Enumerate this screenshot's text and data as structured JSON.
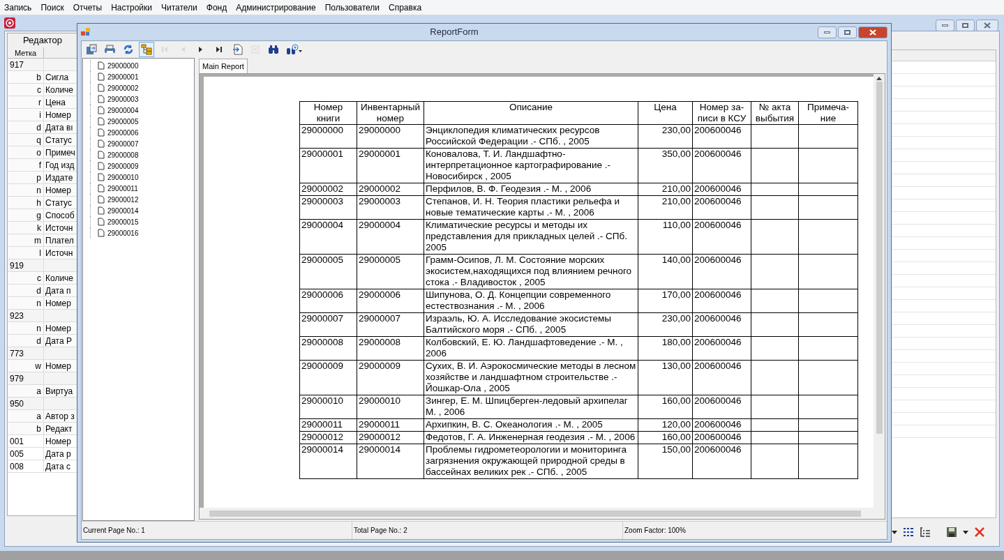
{
  "menu": [
    "Запись",
    "Поиск",
    "Отчеты",
    "Настройки",
    "Читатели",
    "Фонд",
    "Администрирование",
    "Пользователи",
    "Справка"
  ],
  "editor": {
    "tab": "Редактор",
    "column": "Метка",
    "rows": [
      {
        "kind": "group",
        "tag": "917"
      },
      {
        "kind": "sub",
        "tag": "b",
        "name": "Сигла"
      },
      {
        "kind": "sub",
        "tag": "c",
        "name": "Количе"
      },
      {
        "kind": "sub",
        "tag": "r",
        "name": "Цена"
      },
      {
        "kind": "sub",
        "tag": "i",
        "name": "Номер"
      },
      {
        "kind": "sub",
        "tag": "d",
        "name": "Дата вı"
      },
      {
        "kind": "sub",
        "tag": "q",
        "name": "Статус"
      },
      {
        "kind": "sub",
        "tag": "o",
        "name": "Примеч"
      },
      {
        "kind": "sub",
        "tag": "f",
        "name": "Год изд"
      },
      {
        "kind": "sub",
        "tag": "p",
        "name": "Издате"
      },
      {
        "kind": "sub",
        "tag": "n",
        "name": "Номер"
      },
      {
        "kind": "sub",
        "tag": "h",
        "name": "Статус"
      },
      {
        "kind": "sub",
        "tag": "g",
        "name": "Способ"
      },
      {
        "kind": "sub",
        "tag": "k",
        "name": "Источн"
      },
      {
        "kind": "sub",
        "tag": "m",
        "name": "Плател"
      },
      {
        "kind": "sub",
        "tag": "l",
        "name": "Источн"
      },
      {
        "kind": "group",
        "tag": "919"
      },
      {
        "kind": "sub",
        "tag": "c",
        "name": "Количе"
      },
      {
        "kind": "sub",
        "tag": "d",
        "name": "Дата п"
      },
      {
        "kind": "sub",
        "tag": "n",
        "name": "Номер"
      },
      {
        "kind": "group",
        "tag": "923"
      },
      {
        "kind": "sub",
        "tag": "n",
        "name": "Номер"
      },
      {
        "kind": "sub",
        "tag": "d",
        "name": "Дата Р"
      },
      {
        "kind": "group",
        "tag": "773"
      },
      {
        "kind": "sub",
        "tag": "w",
        "name": "Номер"
      },
      {
        "kind": "group",
        "tag": "979"
      },
      {
        "kind": "sub",
        "tag": "a",
        "name": "Виртуа"
      },
      {
        "kind": "group",
        "tag": "950"
      },
      {
        "kind": "sub",
        "tag": "a",
        "name": "Автор з"
      },
      {
        "kind": "sub",
        "tag": "b",
        "name": "Редакт"
      },
      {
        "kind": "field",
        "tag": "001",
        "name": "Номер"
      },
      {
        "kind": "field",
        "tag": "005",
        "name": "Дата р"
      },
      {
        "kind": "field",
        "tag": "008",
        "name": "Дата с"
      }
    ]
  },
  "report_form": {
    "title": "ReportForm",
    "toolbar": [
      {
        "kind": "export",
        "disabled": false,
        "selected": false
      },
      {
        "kind": "print",
        "disabled": false,
        "selected": false
      },
      {
        "kind": "refresh",
        "disabled": false,
        "selected": false
      },
      {
        "kind": "tree",
        "disabled": false,
        "selected": true
      },
      {
        "kind": "first",
        "disabled": true,
        "selected": false
      },
      {
        "kind": "prev",
        "disabled": true,
        "selected": false
      },
      {
        "kind": "next",
        "disabled": false,
        "selected": false
      },
      {
        "kind": "last",
        "disabled": false,
        "selected": false
      },
      {
        "kind": "goto",
        "disabled": false,
        "selected": false
      },
      {
        "kind": "stop",
        "disabled": true,
        "selected": false
      },
      {
        "kind": "find",
        "disabled": false,
        "selected": false
      },
      {
        "kind": "zoom",
        "disabled": false,
        "selected": false
      }
    ],
    "tree": [
      "29000000",
      "29000001",
      "29000002",
      "29000003",
      "29000004",
      "29000005",
      "29000006",
      "29000007",
      "29000008",
      "29000009",
      "29000010",
      "29000011",
      "29000012",
      "29000014",
      "29000015",
      "29000016"
    ],
    "tabs": [
      {
        "label": "Main Report",
        "selected": true
      }
    ],
    "table": {
      "columns": [
        "Номер книги",
        "Инвентарный номер",
        "Описание",
        "Цена",
        "Номер за-писи в КСУ",
        "№ акта выбытия",
        "Примеча-ние"
      ],
      "rows": [
        [
          "29000000",
          "29000000",
          "Энциклопедия климатических ресурсов Российской Федерации .- СПб. , 2005",
          "230,00",
          "200600046"
        ],
        [
          "29000001",
          "29000001",
          "Коновалова, Т. И. Ландшафтно-интерпретационное картографирование .- Новосибирск , 2005",
          "350,00",
          "200600046"
        ],
        [
          "29000002",
          "29000002",
          "Перфилов, В. Ф. Геодезия .- М. , 2006",
          "210,00",
          "200600046"
        ],
        [
          "29000003",
          "29000003",
          "Степанов, И. Н. Теория пластики рельефа и новые тематические карты .- М. , 2006",
          "210,00",
          "200600046"
        ],
        [
          "29000004",
          "29000004",
          "Климатические ресурсы и методы их представления для прикладных целей .- СПб. 2005",
          "110,00",
          "200600046"
        ],
        [
          "29000005",
          "29000005",
          "Грамм-Осипов, Л. М. Состояние морских экосистем,находящихся под влиянием речного стока .- Владивосток , 2005",
          "140,00",
          "200600046"
        ],
        [
          "29000006",
          "29000006",
          "Шипунова, О. Д. Концепции современного естествознания .- М. , 2006",
          "170,00",
          "200600046"
        ],
        [
          "29000007",
          "29000007",
          "Израэль, Ю. А. Исследование экосистемы Балтийского моря .- СПб. , 2005",
          "230,00",
          "200600046"
        ],
        [
          "29000008",
          "29000008",
          "Колбовский, Е. Ю. Ландшафтоведение .- М. , 2006",
          "180,00",
          "200600046"
        ],
        [
          "29000009",
          "29000009",
          "Сухих, В. И. Аэрокосмические методы в лесном хозяйстве и ландшафтном строительстве .- Йошкар-Ола , 2005",
          "130,00",
          "200600046"
        ],
        [
          "29000010",
          "29000010",
          "Зингер, Е. М. Шпицберген-ледовый архипелаг М. , 2006",
          "160,00",
          "200600046"
        ],
        [
          "29000011",
          "29000011",
          "Архипкин, В. С. Океанология .- М. , 2005",
          "120,00",
          "200600046"
        ],
        [
          "29000012",
          "29000012",
          "Федотов, Г. А. Инженерная геодезия .- М. , 2006",
          "160,00",
          "200600046"
        ],
        [
          "29000014",
          "29000014",
          "Проблемы гидрометеорологии и мониторинга загрязнения окружающей природной среды в бассейнах великих рек .- СПб. , 2005",
          "150,00",
          "200600046"
        ]
      ]
    },
    "status": [
      "Current Page No.: 1",
      "Total Page No.: 2",
      "Zoom Factor: 100%"
    ]
  }
}
